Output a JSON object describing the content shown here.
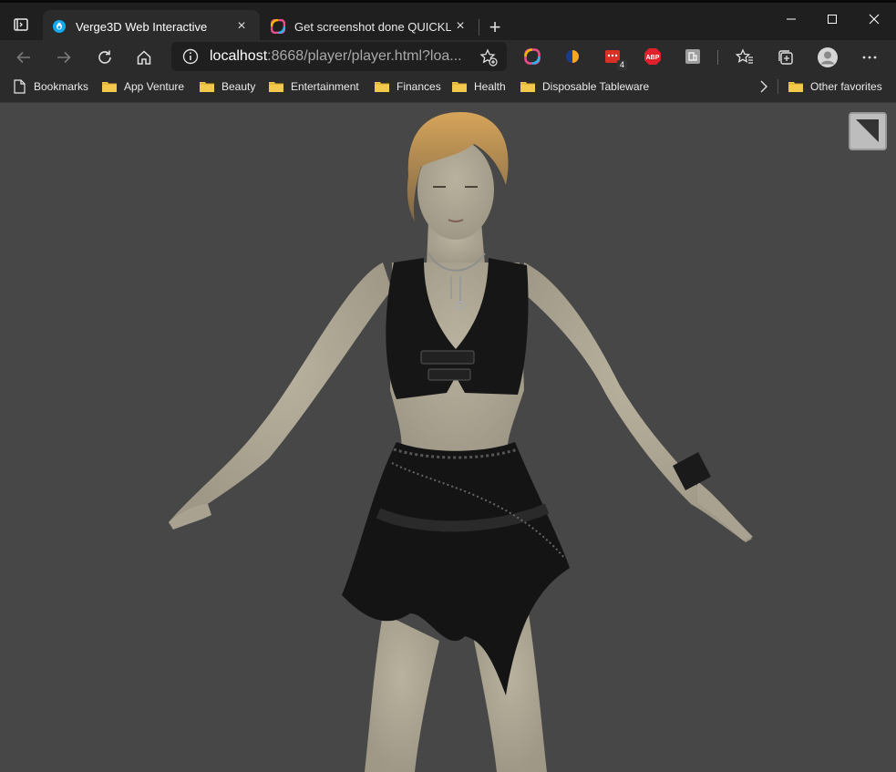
{
  "browser": {
    "tabs": [
      {
        "title": "Verge3D Web Interactive",
        "close": "×",
        "favicon": "verge3d-icon",
        "active": true
      },
      {
        "title": "Get screenshot done QUICKLY –",
        "close": "×",
        "favicon": "colorful-ring-icon",
        "active": false
      }
    ],
    "new_tab": "+",
    "window_controls": {
      "minimize": "minimize-icon",
      "maximize": "maximize-icon",
      "close": "close-icon"
    },
    "address": {
      "host": "localhost",
      "rest": ":8668/player/player.html?loa..."
    },
    "extensions": [
      {
        "name": "colorful-ring-extension-icon"
      },
      {
        "name": "orange-blue-extension-icon"
      },
      {
        "name": "red-calendar-extension-icon",
        "badge": "4"
      },
      {
        "name": "adblock-plus-extension-icon",
        "label": "ABP"
      },
      {
        "name": "grey-square-extension-icon"
      }
    ]
  },
  "bookmarks_bar": {
    "items": [
      {
        "label": "Bookmarks",
        "icon": "page-icon"
      },
      {
        "label": "App Venture",
        "icon": "folder-icon"
      },
      {
        "label": "Beauty",
        "icon": "folder-icon"
      },
      {
        "label": "Entertainment",
        "icon": "folder-icon"
      },
      {
        "label": "Finances",
        "icon": "folder-icon"
      },
      {
        "label": "Health",
        "icon": "folder-icon"
      },
      {
        "label": "Disposable Tableware",
        "icon": "folder-icon"
      }
    ],
    "other_favorites": "Other favorites"
  },
  "viewer": {
    "background": "#474747",
    "fullscreen_button": "fullscreen-icon",
    "model": "3D character model in T-pose wearing black top and layered skirt"
  },
  "colors": {
    "frame": "#1f1f1f",
    "toolbar": "#2b2b2b",
    "folder": "#f2c94c",
    "accent": "#0a84ff"
  }
}
